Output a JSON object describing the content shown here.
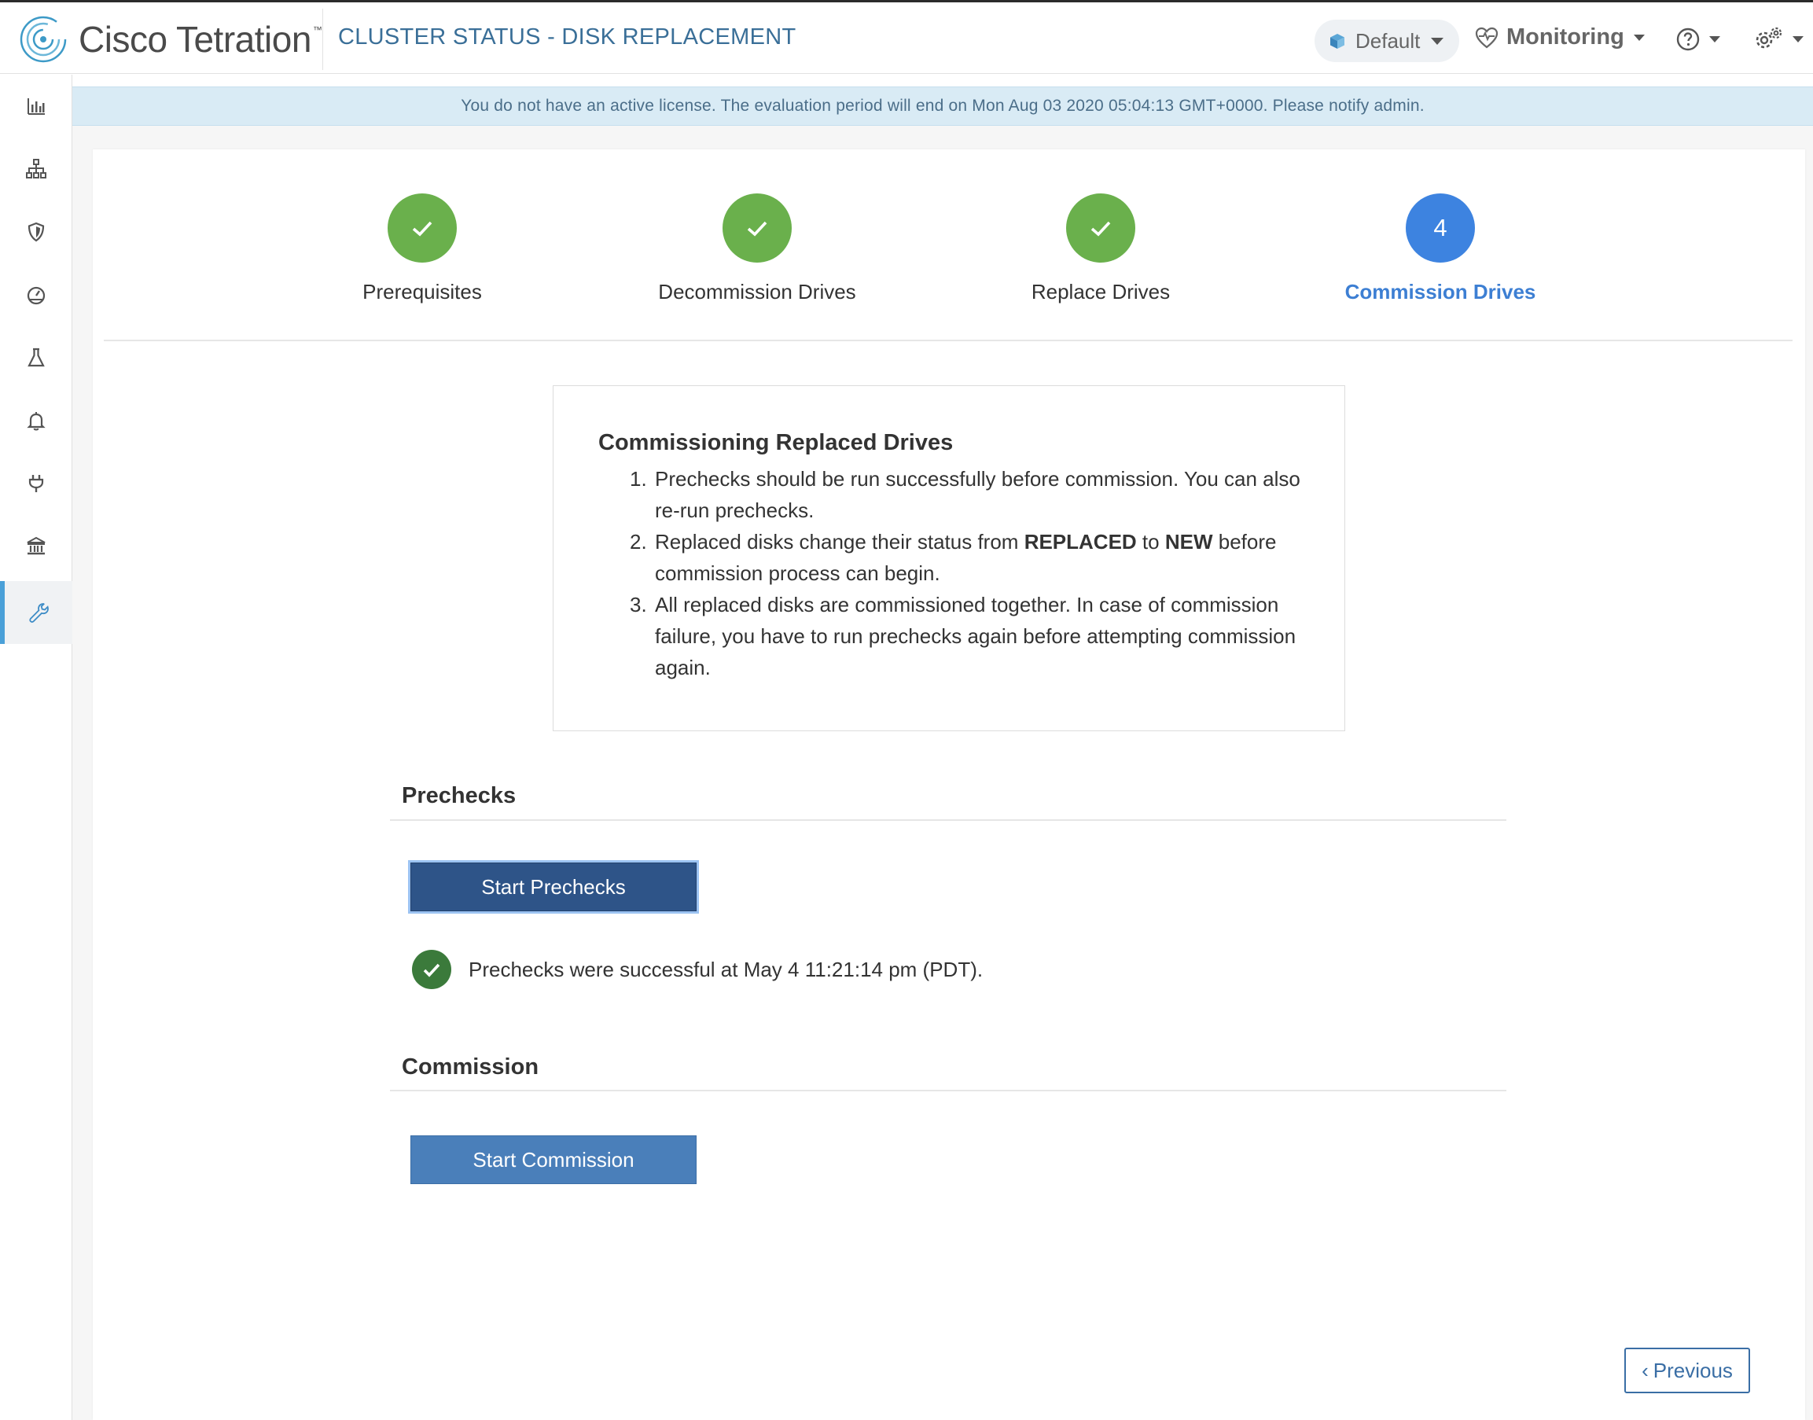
{
  "app": {
    "brand": "Cisco Tetration",
    "trademark": "™",
    "page_title": "CLUSTER STATUS - DISK REPLACEMENT"
  },
  "header": {
    "scope_label": "Default",
    "monitoring_label": "Monitoring"
  },
  "sidebar": {
    "items": [
      {
        "icon": "bar-chart-icon"
      },
      {
        "icon": "hierarchy-icon"
      },
      {
        "icon": "shield-icon"
      },
      {
        "icon": "dashboard-gauge-icon"
      },
      {
        "icon": "flask-icon"
      },
      {
        "icon": "bell-icon"
      },
      {
        "icon": "plug-icon"
      },
      {
        "icon": "bank-icon"
      },
      {
        "icon": "wrench-icon",
        "active": true
      }
    ]
  },
  "banner": {
    "text": "You do not have an active license. The evaluation period will end on Mon Aug 03 2020 05:04:13 GMT+0000.   Please notify admin."
  },
  "stepper": {
    "steps": [
      {
        "label": "Prerequisites",
        "status": "done"
      },
      {
        "label": "Decommission Drives",
        "status": "done"
      },
      {
        "label": "Replace Drives",
        "status": "done"
      },
      {
        "label": "Commission Drives",
        "status": "active",
        "number": "4"
      }
    ]
  },
  "info": {
    "title": "Commissioning Replaced Drives",
    "items": [
      {
        "n": "1.",
        "text": "Prechecks should be run successfully before commission. You can also re-run prechecks."
      },
      {
        "n": "2.",
        "pre": "Replaced disks change their status from ",
        "b1": "REPLACED",
        "mid": " to ",
        "b2": "NEW",
        "post": " before commission process can begin."
      },
      {
        "n": "3.",
        "text": "All replaced disks are commissioned together. In case of commission failure, you have to run prechecks again before attempting commission again."
      }
    ]
  },
  "prechecks": {
    "title": "Prechecks",
    "button_label": "Start Prechecks",
    "status_text": "Prechecks were successful at May 4 11:21:14 pm (PDT)."
  },
  "commission": {
    "title": "Commission",
    "button_label": "Start Commission"
  },
  "footer": {
    "previous_label": "Previous"
  },
  "colors": {
    "done": "#6ab04c",
    "active": "#3d83e0",
    "primary_dark": "#2e5488",
    "primary": "#4a7fba",
    "banner_bg": "#d9ebf5"
  }
}
